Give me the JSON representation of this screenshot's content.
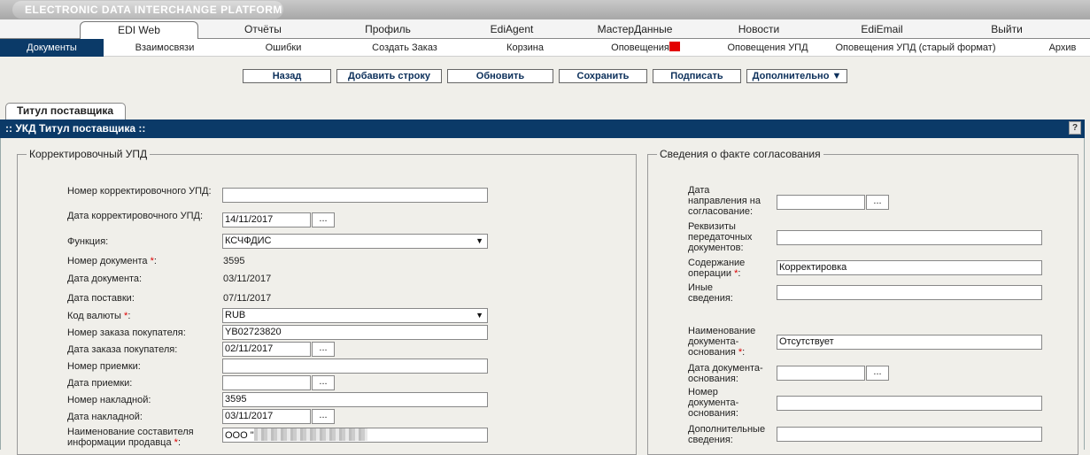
{
  "banner": {
    "title": "ELECTRONIC DATA INTERCHANGE PLATFORM"
  },
  "tabs": [
    "EDI Web",
    "Отчёты",
    "Профиль",
    "EdiAgent",
    "МастерДанные",
    "Новости",
    "EdiEmail",
    "Выйти"
  ],
  "subnav": [
    "Документы",
    "Взаимосвязи",
    "Ошибки",
    "Создать Заказ",
    "Корзина",
    "Оповещения",
    "Оповещения УПД",
    "Оповещения УПД (старый формат)",
    "Архив"
  ],
  "toolbar": {
    "back": "Назад",
    "add_row": "Добавить строку",
    "refresh": "Обновить",
    "save": "Сохранить",
    "sign": "Подписать",
    "more": "Дополнительно ▼"
  },
  "page_tab": "Титул поставщика",
  "panel_title": ":: УКД Титул поставщика ::",
  "help": "?",
  "dots": "...",
  "required": "*",
  "left": {
    "legend": "Корректировочный УПД",
    "fields": {
      "corr_num": "Номер корректировочного УПД:",
      "corr_date": "Дата корректировочного УПД:",
      "function": "Функция:",
      "doc_num": "Номер документа",
      "doc_date": "Дата документа:",
      "delivery_date": "Дата поставки:",
      "currency": "Код валюты",
      "buyer_order_num": "Номер заказа покупателя:",
      "buyer_order_date": "Дата заказа покупателя:",
      "receipt_num": "Номер приемки:",
      "receipt_date": "Дата приемки:",
      "waybill_num": "Номер накладной:",
      "waybill_date": "Дата накладной:",
      "composer_name_1": "Наименование составителя",
      "composer_name_2": "информации продавца"
    },
    "values": {
      "corr_date": "14/11/2017",
      "function": "КСЧФДИС",
      "doc_num": "3595",
      "doc_date": "03/11/2017",
      "delivery_date": "07/11/2017",
      "currency": "RUB",
      "buyer_order_num": "YB02723820",
      "buyer_order_date": "02/11/2017",
      "waybill_num": "3595",
      "waybill_date": "03/11/2017",
      "composer_name": "ООО \""
    }
  },
  "right": {
    "legend": "Сведения о факте согласования",
    "fields": {
      "send_date": [
        "Дата",
        "направления на",
        "согласование:"
      ],
      "transfer_docs": [
        "Реквизиты",
        "передаточных",
        "документов:"
      ],
      "operation": [
        "Содержание",
        "операции"
      ],
      "other": [
        "Иные",
        "сведения:"
      ],
      "base_name": [
        "Наименование",
        "документа-",
        "основания"
      ],
      "base_date": [
        "Дата документа-",
        "основания:"
      ],
      "base_num": [
        "Номер",
        "документа-",
        "основания:"
      ],
      "extra": [
        "Дополнительные",
        "сведения:"
      ]
    },
    "values": {
      "operation": "Корректировка",
      "base_name": "Отсутствует"
    }
  },
  "colors": {
    "nav_active": "#0b3a68",
    "accent": "#0b3a68",
    "required": "#dd0000",
    "badge": "#e30000"
  }
}
